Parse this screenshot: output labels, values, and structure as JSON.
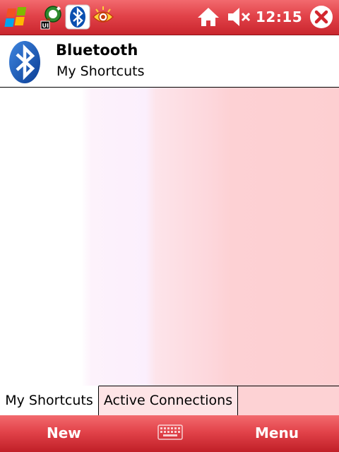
{
  "status_bar": {
    "time": "12:15",
    "icons": [
      "windows-start-icon",
      "network-status-icon",
      "bluetooth-tray-icon",
      "eye-tray-icon",
      "home-icon",
      "speaker-muted-icon",
      "close-icon"
    ]
  },
  "header": {
    "title": "Bluetooth",
    "subtitle": "My Shortcuts",
    "icon": "bluetooth-icon"
  },
  "tabs": [
    {
      "label": "My Shortcuts",
      "active": true
    },
    {
      "label": "Active Connections",
      "active": false
    }
  ],
  "softkeys": {
    "left": "New",
    "right": "Menu",
    "center_icon": "keyboard-icon"
  },
  "colors": {
    "bar_red": "#e2434a",
    "content_pink": "#fdd1d4",
    "bluetooth_blue": "#0a4fb0"
  }
}
